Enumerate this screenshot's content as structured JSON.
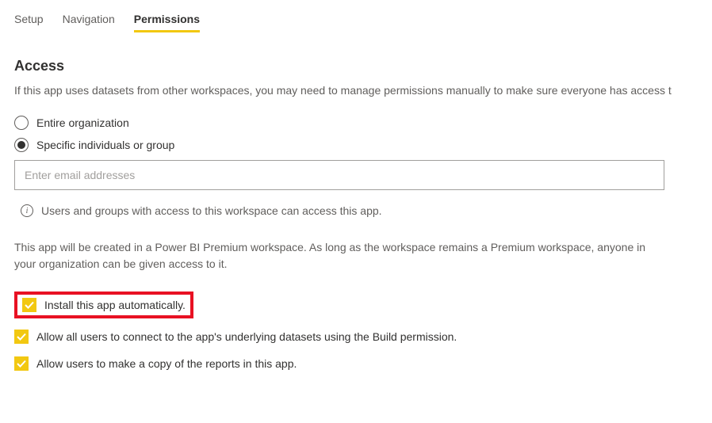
{
  "tabs": {
    "setup": "Setup",
    "navigation": "Navigation",
    "permissions": "Permissions"
  },
  "section": {
    "heading": "Access",
    "description": "If this app uses datasets from other workspaces, you may need to manage permissions manually to make sure everyone has access t"
  },
  "radio": {
    "entire_org": "Entire organization",
    "specific": "Specific individuals or group"
  },
  "email_input": {
    "placeholder": "Enter email addresses"
  },
  "info": {
    "text": "Users and groups with access to this workspace can access this app."
  },
  "premium_note": "This app will be created in a Power BI Premium workspace. As long as the workspace remains a Premium workspace, anyone in your organization can be given access to it.",
  "checkboxes": {
    "install_auto": "Install this app automatically.",
    "allow_build": "Allow all users to connect to the app's underlying datasets using the Build permission.",
    "allow_copy": "Allow users to make a copy of the reports in this app."
  }
}
